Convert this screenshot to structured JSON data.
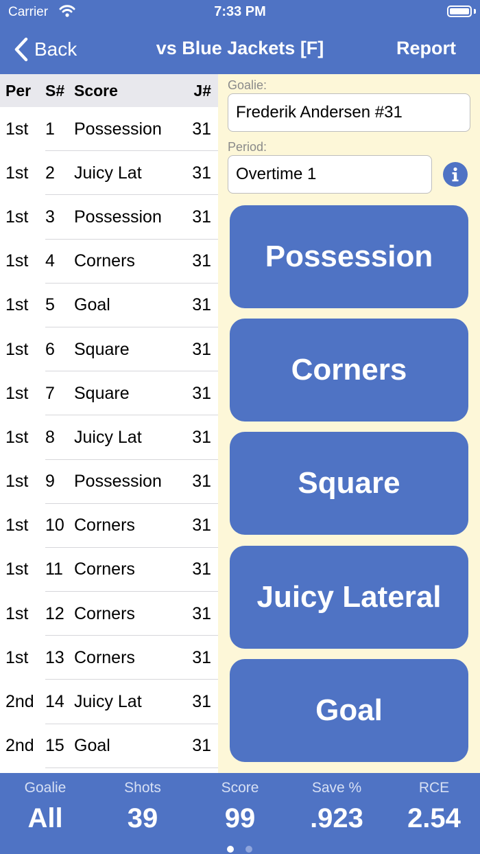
{
  "status_bar": {
    "carrier": "Carrier",
    "time": "7:33 PM"
  },
  "nav": {
    "back_label": "Back",
    "title": "vs Blue Jackets [F]",
    "report_label": "Report"
  },
  "table": {
    "headers": {
      "per": "Per",
      "shot": "S#",
      "score": "Score",
      "jersey": "J#"
    },
    "rows": [
      {
        "per": "1st",
        "shot": "1",
        "score": "Possession",
        "jersey": "31"
      },
      {
        "per": "1st",
        "shot": "2",
        "score": "Juicy Lat",
        "jersey": "31"
      },
      {
        "per": "1st",
        "shot": "3",
        "score": "Possession",
        "jersey": "31"
      },
      {
        "per": "1st",
        "shot": "4",
        "score": "Corners",
        "jersey": "31"
      },
      {
        "per": "1st",
        "shot": "5",
        "score": "Goal",
        "jersey": "31"
      },
      {
        "per": "1st",
        "shot": "6",
        "score": "Square",
        "jersey": "31"
      },
      {
        "per": "1st",
        "shot": "7",
        "score": "Square",
        "jersey": "31"
      },
      {
        "per": "1st",
        "shot": "8",
        "score": "Juicy Lat",
        "jersey": "31"
      },
      {
        "per": "1st",
        "shot": "9",
        "score": "Possession",
        "jersey": "31"
      },
      {
        "per": "1st",
        "shot": "10",
        "score": "Corners",
        "jersey": "31"
      },
      {
        "per": "1st",
        "shot": "11",
        "score": "Corners",
        "jersey": "31"
      },
      {
        "per": "1st",
        "shot": "12",
        "score": "Corners",
        "jersey": "31"
      },
      {
        "per": "1st",
        "shot": "13",
        "score": "Corners",
        "jersey": "31"
      },
      {
        "per": "2nd",
        "shot": "14",
        "score": "Juicy Lat",
        "jersey": "31"
      },
      {
        "per": "2nd",
        "shot": "15",
        "score": "Goal",
        "jersey": "31"
      }
    ]
  },
  "panel": {
    "goalie_label": "Goalie:",
    "goalie_value": "Frederik Andersen #31",
    "period_label": "Period:",
    "period_value": "Overtime 1",
    "buttons": [
      "Possession",
      "Corners",
      "Square",
      "Juicy Lateral",
      "Goal"
    ]
  },
  "stats": [
    {
      "label": "Goalie",
      "value": "All"
    },
    {
      "label": "Shots",
      "value": "39"
    },
    {
      "label": "Score",
      "value": "99"
    },
    {
      "label": "Save %",
      "value": ".923"
    },
    {
      "label": "RCE",
      "value": "2.54"
    }
  ],
  "colors": {
    "accent": "#4f73c4",
    "panel_bg": "#fdf7d8",
    "header_bg": "#e8e8ed"
  },
  "page_indicator": {
    "pages": 2,
    "current": 1
  }
}
